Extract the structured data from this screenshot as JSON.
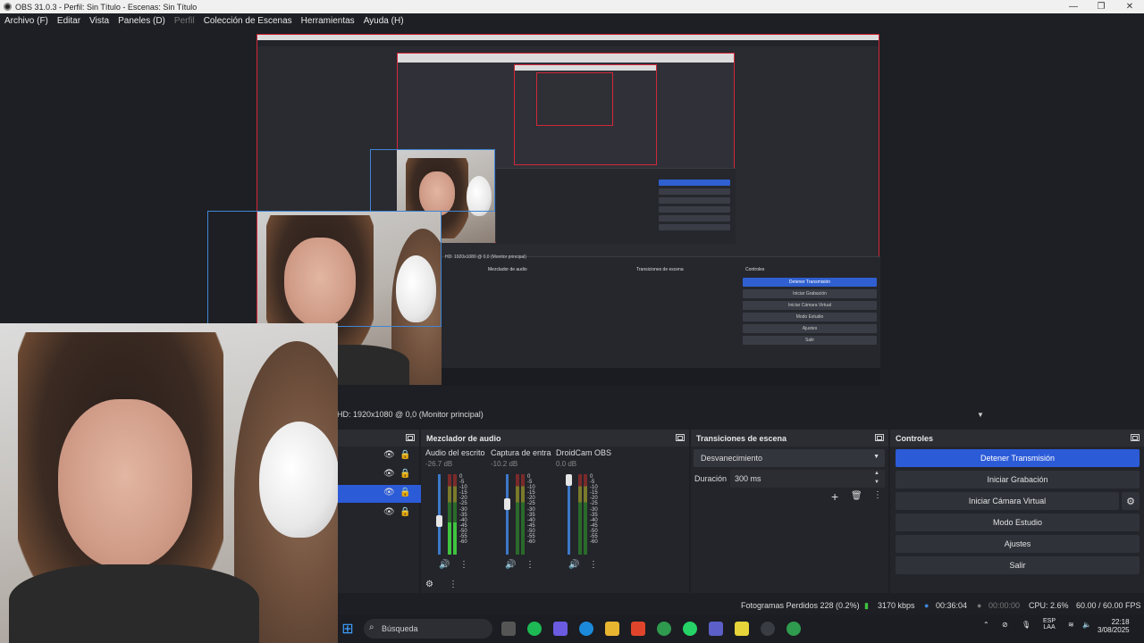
{
  "window": {
    "title": "OBS 31.0.3 - Perfil: Sin Título - Escenas: Sin Título",
    "minimize": "—",
    "maximize": "❐",
    "close": "✕"
  },
  "menu": {
    "items": [
      "Archivo (F)",
      "Editar",
      "Vista",
      "Paneles (D)",
      "Perfil",
      "Colección de Escenas",
      "Herramientas",
      "Ayuda (H)"
    ]
  },
  "preview": {
    "mini_mixer_title": "Mezclador de audio",
    "mini_transitions_title": "Transiciones de escena",
    "mini_controls_title": "Controles",
    "mini_source_label": "HD: 1920x1080 @ 0,0 (Monitor principal)",
    "mini_controls": [
      "Detener Transmisión",
      "Iniciar Grabación",
      "Iniciar Cámara Virtual",
      "Modo Estudio",
      "Ajustes",
      "Salir"
    ]
  },
  "source_bar": {
    "label": "HD: 1920x1080 @ 0,0 (Monitor principal)",
    "caret": "▼"
  },
  "docks": {
    "mixer_title": "Mezclador de audio",
    "transitions_title": "Transiciones de escena",
    "controls_title": "Controles"
  },
  "mixer": {
    "channels": [
      {
        "name": "Audio del escrito",
        "db": "-26.7 dB"
      },
      {
        "name": "Captura de entra",
        "db": "-10.2 dB"
      },
      {
        "name": "DroidCam OBS",
        "db": "0.0 dB"
      }
    ],
    "scale": [
      "0",
      "-5",
      "-10",
      "-15",
      "-20",
      "-25",
      "-30",
      "-35",
      "-40",
      "-45",
      "-50",
      "-55",
      "-60"
    ]
  },
  "transitions": {
    "selected": "Desvanecimiento",
    "duration_label": "Duración",
    "duration_value": "300 ms",
    "add": "+",
    "delete": "🗑",
    "more": "⋮"
  },
  "controls": {
    "stop_stream": "Detener Transmisión",
    "start_recording": "Iniciar Grabación",
    "start_virtual_cam": "Iniciar Cámara Virtual",
    "studio_mode": "Modo Estudio",
    "settings": "Ajustes",
    "exit": "Salir"
  },
  "status": {
    "dropped_frames": "Fotogramas Perdidos 228 (0.2%)",
    "bitrate": "3170 kbps",
    "stream_time": "00:36:04",
    "record_time": "00:00:00",
    "cpu": "CPU: 2.6%",
    "fps": "60.00 / 60.00 FPS"
  },
  "taskbar": {
    "search_placeholder": "Búsqueda",
    "lang": "ESP",
    "lang_sub": "LAA",
    "time": "22:18",
    "date": "3/08/2025"
  },
  "colors": {
    "accent": "#2c5bd8",
    "selection_red": "#d2263a",
    "panel_bg": "#23252b"
  }
}
